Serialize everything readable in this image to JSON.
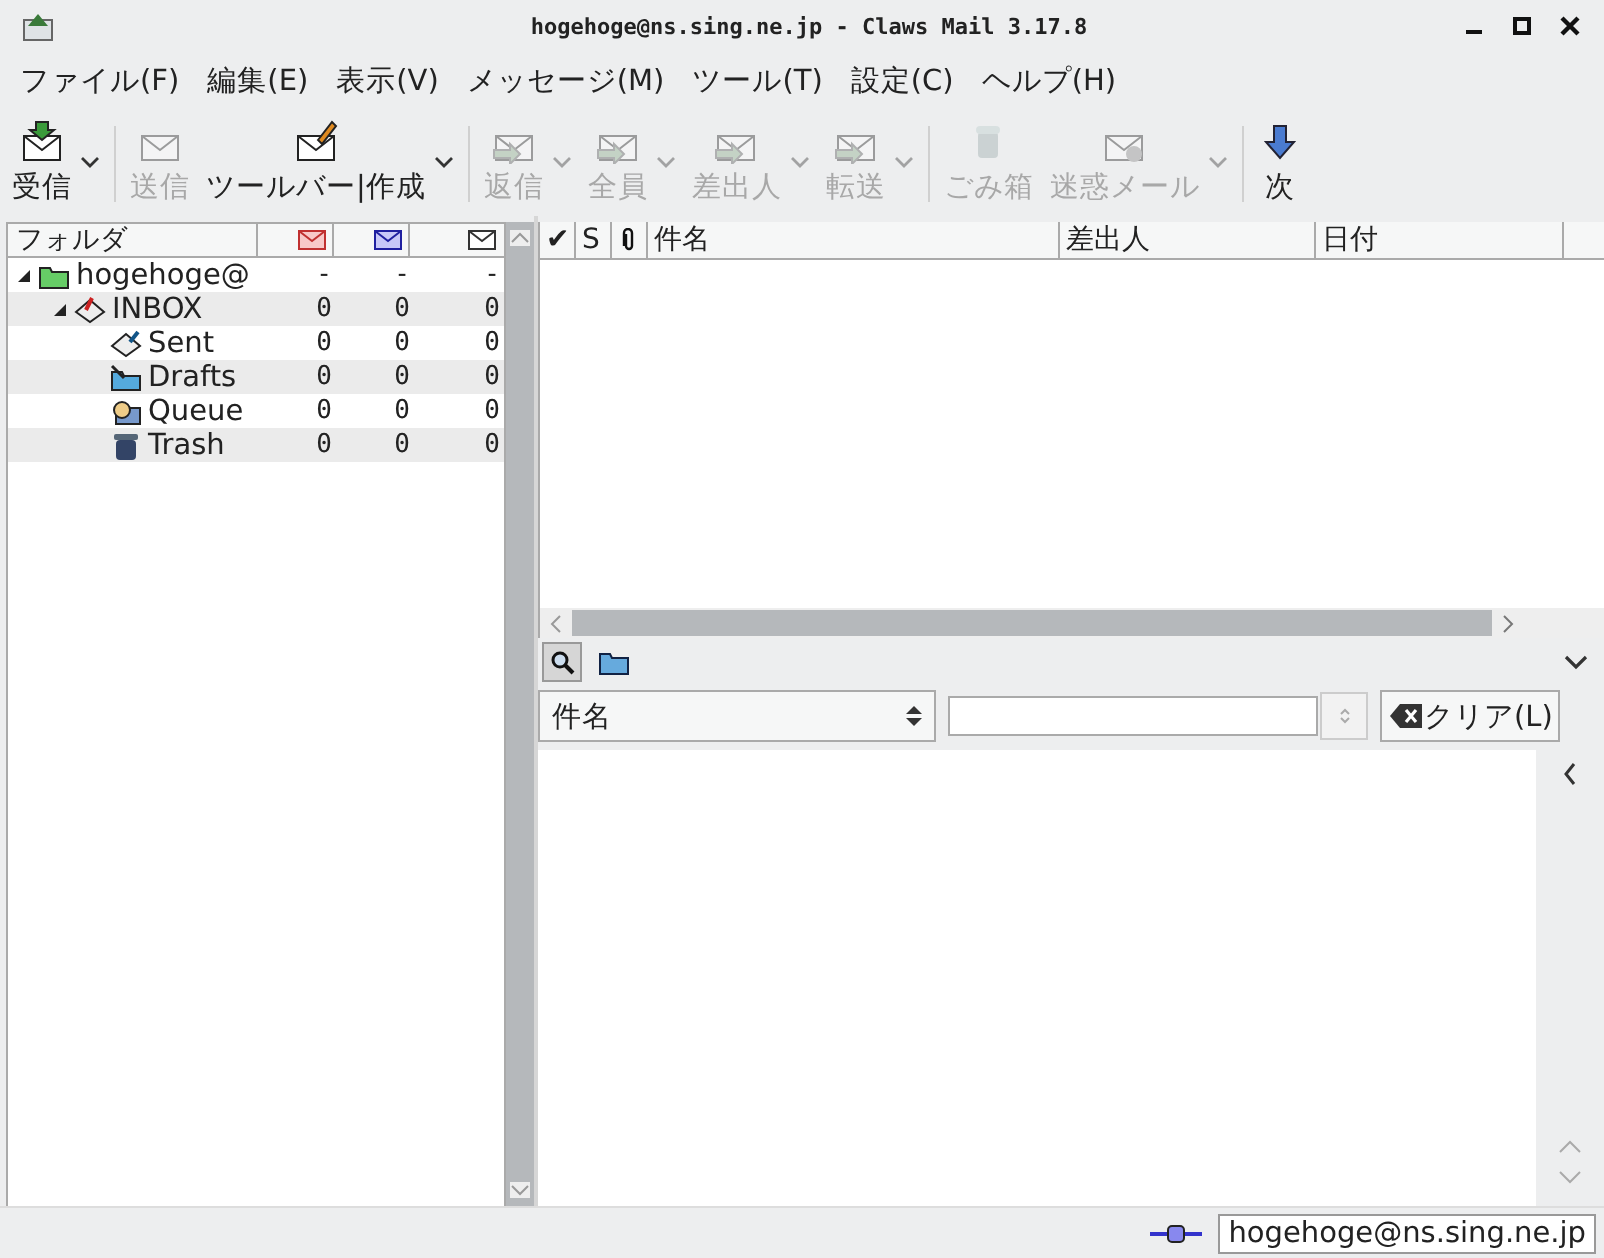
{
  "window": {
    "title": "hogehoge@ns.sing.ne.jp - Claws Mail 3.17.8"
  },
  "menu": [
    "ファイル(F)",
    "編集(E)",
    "表示(V)",
    "メッセージ(M)",
    "ツール(T)",
    "設定(C)",
    "ヘルプ(H)"
  ],
  "toolbar": [
    {
      "label": "受信",
      "disabled": false,
      "dropdown": true,
      "separator_after": true
    },
    {
      "label": "送信",
      "disabled": true,
      "dropdown": false,
      "separator_after": false
    },
    {
      "label": "ツールバー|作成",
      "disabled": false,
      "dropdown": true,
      "separator_after": true
    },
    {
      "label": "返信",
      "disabled": true,
      "dropdown": true,
      "separator_after": false
    },
    {
      "label": "全員",
      "disabled": true,
      "dropdown": true,
      "separator_after": false
    },
    {
      "label": "差出人",
      "disabled": true,
      "dropdown": true,
      "separator_after": false
    },
    {
      "label": "転送",
      "disabled": true,
      "dropdown": true,
      "separator_after": true
    },
    {
      "label": "ごみ箱",
      "disabled": true,
      "dropdown": false,
      "separator_after": false
    },
    {
      "label": "迷惑メール",
      "disabled": true,
      "dropdown": true,
      "separator_after": true
    },
    {
      "label": "次",
      "disabled": false,
      "dropdown": false,
      "separator_after": false
    }
  ],
  "folders": {
    "header": "フォルダ",
    "tree": [
      {
        "name": "hogehoge@",
        "expanded": true,
        "new": "-",
        "unread": "-",
        "total": "-",
        "children": [
          {
            "name": "INBOX",
            "expanded": true,
            "new": "0",
            "unread": "0",
            "total": "0",
            "children": [
              {
                "name": "Sent",
                "new": "0",
                "unread": "0",
                "total": "0"
              },
              {
                "name": "Drafts",
                "new": "0",
                "unread": "0",
                "total": "0"
              },
              {
                "name": "Queue",
                "new": "0",
                "unread": "0",
                "total": "0"
              },
              {
                "name": "Trash",
                "new": "0",
                "unread": "0",
                "total": "0"
              }
            ]
          }
        ]
      }
    ]
  },
  "message_list": {
    "columns": [
      "✔",
      "S",
      "件名",
      "差出人",
      "日付"
    ]
  },
  "search": {
    "field": "件名",
    "clear_button": "クリア(L)"
  },
  "status_bar": {
    "account": "hogehoge@ns.sing.ne.jp"
  }
}
